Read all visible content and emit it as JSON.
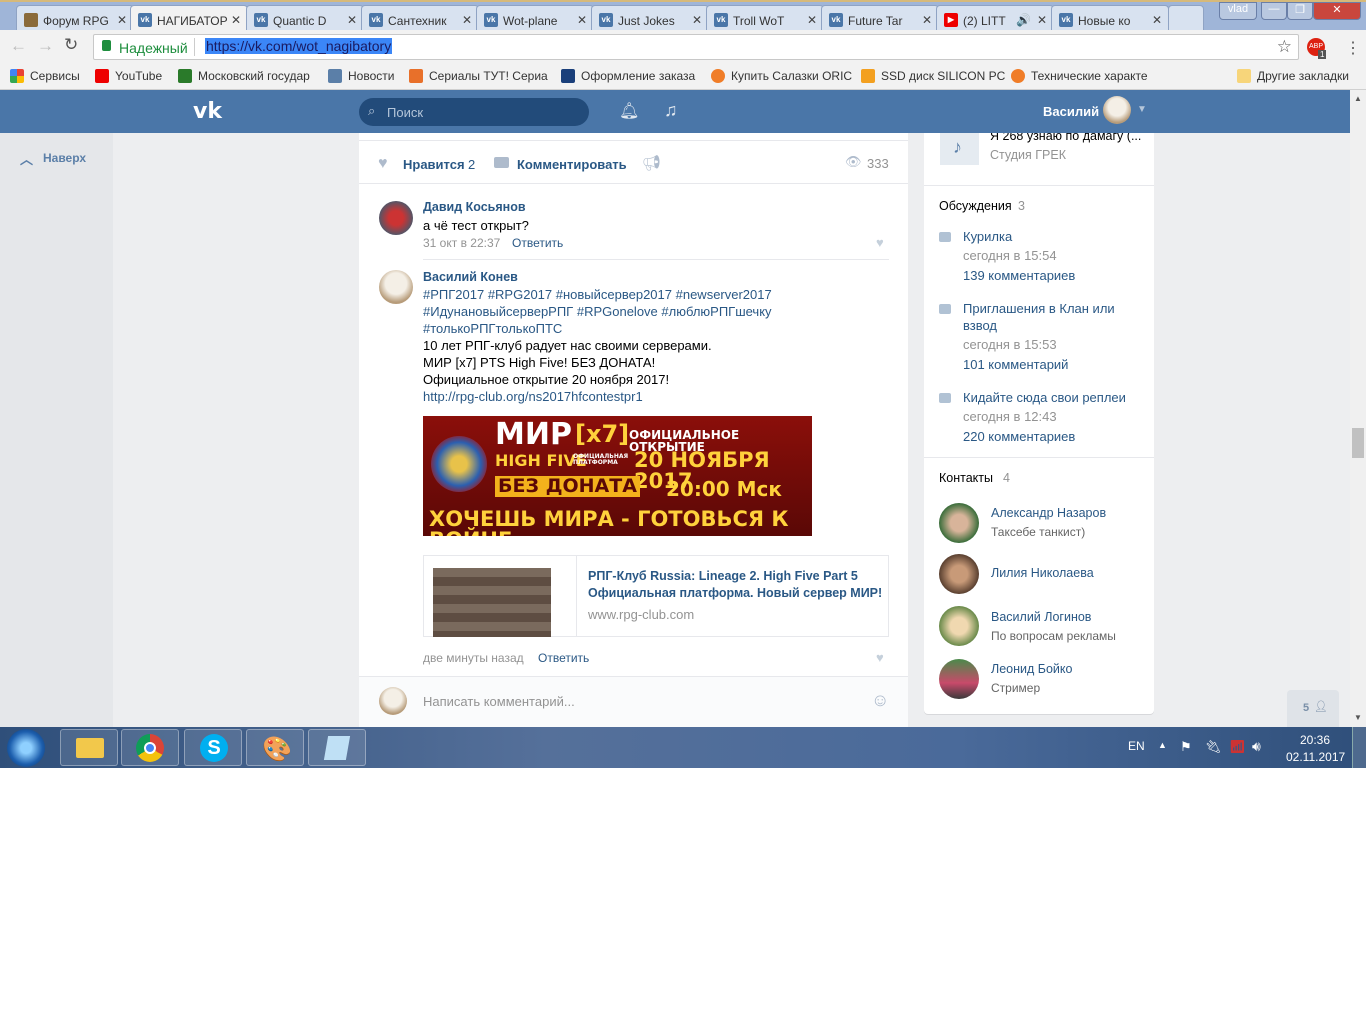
{
  "browser": {
    "tabs": [
      {
        "title": "Форум RPG",
        "icon": "shield"
      },
      {
        "title": "НАГИБАТОРЫ",
        "icon": "vk",
        "active": true
      },
      {
        "title": "Quantic D",
        "icon": "vk"
      },
      {
        "title": "Сантехник",
        "icon": "vk"
      },
      {
        "title": "Wot-plane",
        "icon": "vk"
      },
      {
        "title": "Just Jokes",
        "icon": "vk"
      },
      {
        "title": "Troll WoT",
        "icon": "vk"
      },
      {
        "title": "Future Tar",
        "icon": "vk"
      },
      {
        "title": "(2) LITT",
        "icon": "youtube"
      },
      {
        "title": "Новые ко",
        "icon": "vk"
      }
    ],
    "user": "vlad",
    "secure_label": "Надежный",
    "url": "https://vk.com/wot_nagibatory",
    "abp_badge": "1",
    "bookmarks": [
      {
        "label": "Сервисы",
        "color": "#e94235"
      },
      {
        "label": "YouTube",
        "color": "#e00"
      },
      {
        "label": "Московский государ",
        "color": "#2a7a2a"
      },
      {
        "label": "Новости",
        "color": "#5b7fa8"
      },
      {
        "label": "Сериалы ТУТ! Сериа",
        "color": "#e8702a"
      },
      {
        "label": "Оформление заказа",
        "color": "#1a3f7a"
      },
      {
        "label": "Купить Салазки ORIC",
        "color": "#f07d28"
      },
      {
        "label": "SSD диск SILICON PC",
        "color": "#f3a020"
      },
      {
        "label": "Технические характе",
        "color": "#f07d28"
      }
    ],
    "other_bookmarks": "Другие закладки"
  },
  "vk": {
    "search_placeholder": "Поиск",
    "user_name": "Василий",
    "back_to_top": "Наверх",
    "post_actions": {
      "like_label": "Нравится",
      "like_count": "2",
      "comment_label": "Комментировать",
      "views": "333"
    },
    "comments": [
      {
        "author": "Давид Косьянов",
        "text": "а чё тест открыт?",
        "time": "31 окт в 22:37",
        "reply": "Ответить"
      },
      {
        "author": "Василий Конев",
        "hashtags1": "#РПГ2017 #RPG2017 #новыйсервер2017 #newserver2017",
        "hashtags2": "#ИдунановыйсерверРПГ #RPGonelove #люблюРПГшечку",
        "hashtags3": "#толькоРПГтолькоПТС",
        "line1": "10 лет РПГ-клуб радует нас своими серверами.",
        "line2": "МИР [x7] PTS High Five! БЕЗ ДОНАТА!",
        "line3": "Официальное открытие 20 ноября 2017!",
        "link": "http://rpg-club.org/ns2017hfcontestpr1",
        "time": "две минуты назад",
        "reply": "Ответить"
      }
    ],
    "banner": {
      "t1": "МИР",
      "t2": "[x7]",
      "t3": "ОФИЦИАЛЬНОЕ ОТКРЫТИЕ",
      "t4": "HIGH FIVE",
      "t5": "ОФИЦИАЛЬНАЯ ПЛАТФОРМА",
      "t6": "20 НОЯБРЯ 2017",
      "t7": "БЕЗ ДОНАТА",
      "t8": "20:00 Мск",
      "t9": "ХОЧЕШЬ МИРА - ГОТОВЬСЯ К ВОЙНЕ"
    },
    "link_card": {
      "title1": "РПГ-Клуб Russia: Lineage 2. High Five Part 5",
      "title2": "Официальная платформа. Новый сервер МИР!",
      "domain": "www.rpg-club.com"
    },
    "comment_placeholder": "Написать комментарий...",
    "audio": {
      "title": "Я 268 узнаю по дамагу (...",
      "artist": "Студия ГРЕК"
    },
    "discussions": {
      "title": "Обсуждения",
      "count": "3",
      "items": [
        {
          "title": "Курилка",
          "time": "сегодня в 15:54",
          "comments": "139 комментариев"
        },
        {
          "title": "Приглашения в Клан или",
          "title2": "взвод",
          "time": "сегодня в 15:53",
          "comments": "101 комментарий"
        },
        {
          "title": "Кидайте сюда свои реплеи",
          "time": "сегодня в 12:43",
          "comments": "220 комментариев"
        }
      ]
    },
    "contacts": {
      "title": "Контакты",
      "count": "4",
      "items": [
        {
          "name": "Александр Назаров",
          "desc": "Таксебе танкист)"
        },
        {
          "name": "Лилия Николаева",
          "desc": ""
        },
        {
          "name": "Василий Логинов",
          "desc": "По вопросам рекламы"
        },
        {
          "name": "Леонид Бойко",
          "desc": "Стример"
        }
      ]
    },
    "online_count": "5"
  },
  "taskbar": {
    "lang": "EN",
    "time": "20:36",
    "date": "02.11.2017"
  }
}
